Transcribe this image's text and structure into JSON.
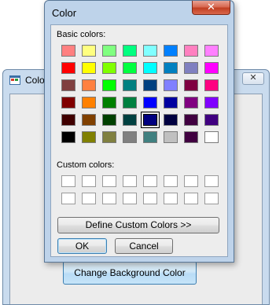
{
  "background_window": {
    "title": "Colo",
    "close_glyph": "✕",
    "change_button_label": "Change Background Color"
  },
  "dialog": {
    "title": "Color",
    "close_glyph": "✕",
    "basic_colors_label": "Basic colors:",
    "custom_colors_label": "Custom colors:",
    "define_button_label": "Define Custom Colors >>",
    "ok_label": "OK",
    "cancel_label": "Cancel",
    "selected_basic_index": 36,
    "basic_colors": [
      "#ff8080",
      "#ffff80",
      "#80ff80",
      "#00ff80",
      "#80ffff",
      "#0080ff",
      "#ff80c0",
      "#ff80ff",
      "#ff0000",
      "#ffff00",
      "#80ff00",
      "#00ff40",
      "#00ffff",
      "#0080c0",
      "#8080c0",
      "#ff00ff",
      "#804040",
      "#ff8040",
      "#00ff00",
      "#008080",
      "#004080",
      "#8080ff",
      "#800040",
      "#ff0080",
      "#800000",
      "#ff8000",
      "#008000",
      "#008040",
      "#0000ff",
      "#0000a0",
      "#800080",
      "#8000ff",
      "#400000",
      "#804000",
      "#004000",
      "#004040",
      "#000080",
      "#000040",
      "#400040",
      "#400080",
      "#000000",
      "#808000",
      "#808040",
      "#808080",
      "#408080",
      "#c0c0c0",
      "#400040",
      "#ffffff"
    ],
    "custom_colors": [
      "#ffffff",
      "#ffffff",
      "#ffffff",
      "#ffffff",
      "#ffffff",
      "#ffffff",
      "#ffffff",
      "#ffffff",
      "#ffffff",
      "#ffffff",
      "#ffffff",
      "#ffffff",
      "#ffffff",
      "#ffffff",
      "#ffffff",
      "#ffffff"
    ]
  }
}
